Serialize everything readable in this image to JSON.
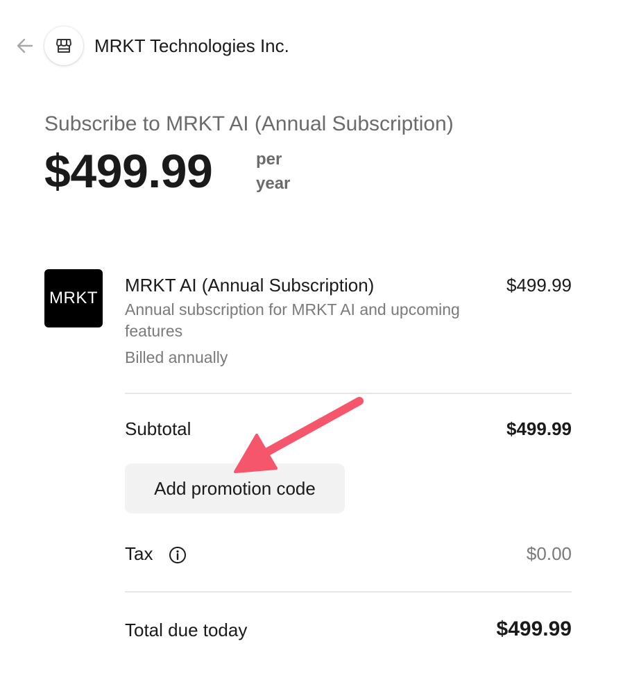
{
  "header": {
    "back_icon": "arrow-left-icon",
    "merchant_icon": "storefront-icon",
    "merchant_name": "MRKT Technologies Inc."
  },
  "summary": {
    "title": "Subscribe to MRKT AI (Annual Subscription)",
    "price": "$499.99",
    "interval": "per year"
  },
  "line_item": {
    "logo_text": "MRKT",
    "name": "MRKT AI (Annual Subscription)",
    "price": "$499.99",
    "description": "Annual subscription for MRKT AI and upcoming features",
    "billing": "Billed annually"
  },
  "totals": {
    "subtotal_label": "Subtotal",
    "subtotal_value": "$499.99",
    "promo_button_label": "Add promotion code",
    "tax_label": "Tax",
    "tax_info_icon": "info-icon",
    "tax_value": "$0.00",
    "total_label": "Total due today",
    "total_value": "$499.99"
  },
  "colors": {
    "annotation_arrow": "#f5566b",
    "muted_text": "#6b6b6b",
    "promo_button_bg": "#f2f2f2",
    "logo_bg": "#000000"
  }
}
